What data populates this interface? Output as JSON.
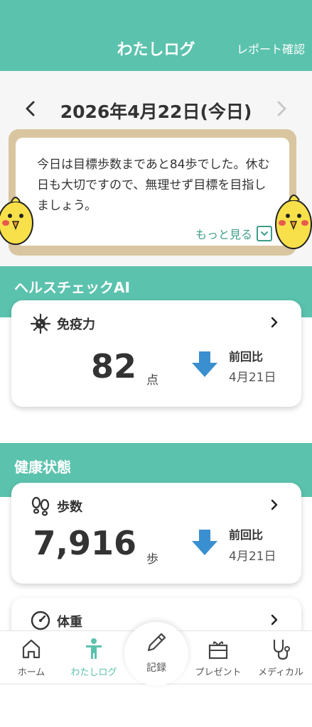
{
  "header": {
    "title": "わたしログ",
    "report_link": "レポート確認"
  },
  "date_nav": {
    "date": "2026年4月22日(今日)"
  },
  "message": {
    "text": "今日は目標歩数まであと84歩でした。休む日も大切ですので、無理せず目標を目指しましょう。",
    "more_label": "もっと見る"
  },
  "health_ai": {
    "section_title": "ヘルスチェックAI",
    "card": {
      "title": "免疫力",
      "value": "82",
      "unit": "点",
      "compare_label": "前回比",
      "compare_date": "4月21日",
      "trend": "down"
    }
  },
  "health_status": {
    "section_title": "健康状態",
    "steps_card": {
      "title": "歩数",
      "value": "7,916",
      "unit": "歩",
      "compare_label": "前回比",
      "compare_date": "4月21日",
      "trend": "down"
    },
    "weight_card": {
      "title": "体重"
    }
  },
  "bottom_nav": {
    "home": "ホーム",
    "log": "わたしログ",
    "record": "記録",
    "present": "プレゼント",
    "medical": "メディカル"
  },
  "colors": {
    "brand": "#5bc2ad",
    "arrow": "#3a8fd0",
    "board": "#d9c6a0",
    "active_nav": "#5bc2ad"
  }
}
